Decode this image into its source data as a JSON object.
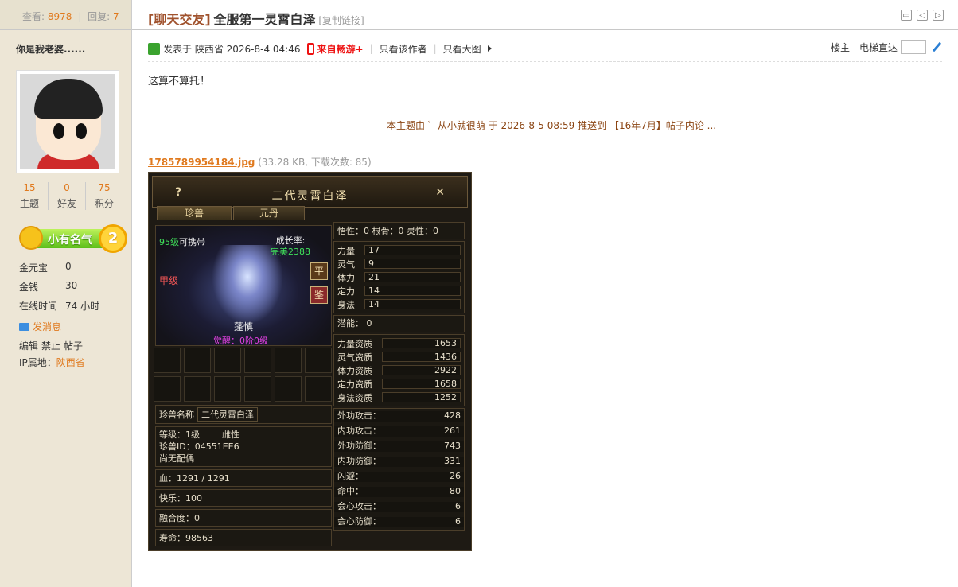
{
  "header": {
    "views_label": "查看:",
    "views": "8978",
    "replies_label": "回复:",
    "replies": "7",
    "category": "[聊天交友]",
    "title": "全服第一灵霄白泽",
    "copy_link": "[复制链接]"
  },
  "profile": {
    "author": "你是我老婆......",
    "counts": [
      {
        "n": "15",
        "l": "主题"
      },
      {
        "n": "0",
        "l": "好友"
      },
      {
        "n": "75",
        "l": "积分"
      }
    ],
    "rank_title": "小有名气",
    "rank_level": "2",
    "info": [
      {
        "k": "金元宝",
        "v": "0"
      },
      {
        "k": "金钱",
        "v": "30"
      },
      {
        "k": "在线时间",
        "v": "74 小时"
      }
    ],
    "send_msg": "发消息",
    "admin": [
      "编辑",
      "禁止",
      "帖子"
    ],
    "ip_label": "IP属地：",
    "ip_value": "陕西省"
  },
  "post": {
    "posted": "发表于 陕西省 2026-8-4 04:46",
    "source": "来自畅游+",
    "only_author": "只看该作者",
    "only_big": "只看大图",
    "floor": "楼主",
    "jump_label": "电梯直达",
    "body": "这算不算托！",
    "notice": "本主题由 ゛从小就很萌 于 2026-8-5 08:59 推送到 【16年7月】帖子内论 ...",
    "attachment_name": "1785789954184.jpg",
    "attachment_info": "(33.28 KB, 下载次数: 85)"
  },
  "game": {
    "title": "二代灵霄白泽",
    "tabs": [
      "珍兽",
      "元丹"
    ],
    "level_num": "95级",
    "level_text": "可携带",
    "growth_label": "成长率:",
    "growth_value": "完美2388",
    "grade": "甲级",
    "btn1": "平",
    "btn2": "鉴",
    "pet_name_short": "蓬慎",
    "wake": "觉醒：0阶0级",
    "pet_name_label": "珍兽名称",
    "pet_name": "二代灵霄白泽",
    "level_line": "等级：1级",
    "gender": "雌性",
    "pet_id": "珍兽ID：04551EE6",
    "spouse": "尚无配偶",
    "hp": "血：1291 / 1291",
    "happy": "快乐：100",
    "fusion": "融合度：0",
    "life": "寿命：98563",
    "aptitudes": "悟性：0   根骨：0   灵性：0",
    "attrs": [
      {
        "k": "力量",
        "v": "17"
      },
      {
        "k": "灵气",
        "v": "9"
      },
      {
        "k": "体力",
        "v": "21"
      },
      {
        "k": "定力",
        "v": "14"
      },
      {
        "k": "身法",
        "v": "14"
      }
    ],
    "potential": "潜能：  0",
    "quals": [
      {
        "k": "力量资质",
        "v": "1653"
      },
      {
        "k": "灵气资质",
        "v": "1436"
      },
      {
        "k": "体力资质",
        "v": "2922"
      },
      {
        "k": "定力资质",
        "v": "1658"
      },
      {
        "k": "身法资质",
        "v": "1252"
      }
    ],
    "combat": [
      {
        "k": "外功攻击：",
        "v": "428"
      },
      {
        "k": "内功攻击：",
        "v": "261"
      },
      {
        "k": "外功防御：",
        "v": "743"
      },
      {
        "k": "内功防御：",
        "v": "331"
      },
      {
        "k": "闪避：",
        "v": "26"
      },
      {
        "k": "命中：",
        "v": "80"
      },
      {
        "k": "会心攻击：",
        "v": "6"
      },
      {
        "k": "会心防御：",
        "v": "6"
      }
    ]
  }
}
